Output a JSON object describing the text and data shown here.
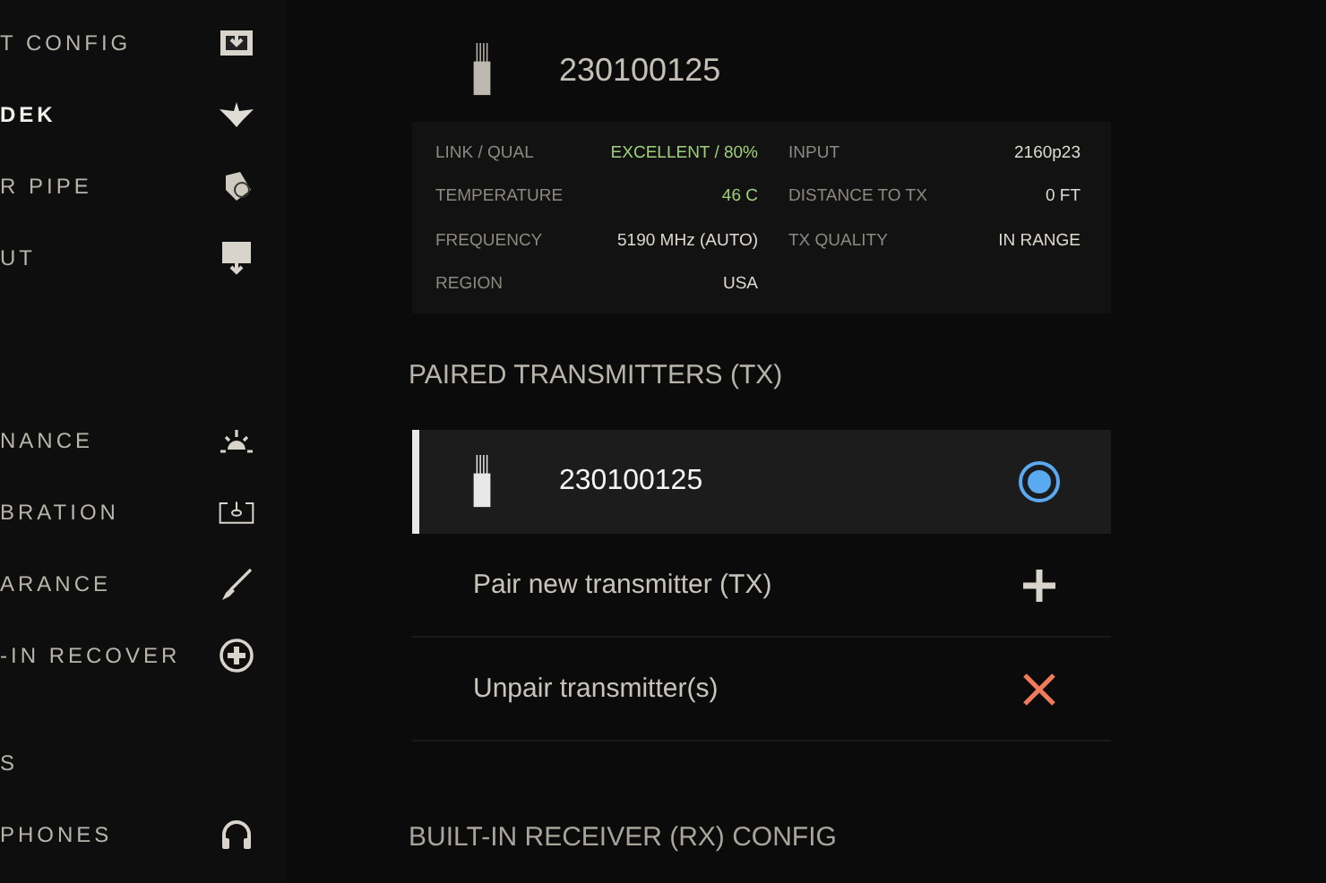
{
  "sidebar": {
    "groups": [
      {
        "items": [
          {
            "label": "T CONFIG",
            "selected": false
          },
          {
            "label": "DEK",
            "selected": true
          },
          {
            "label": "R PIPE",
            "selected": false
          },
          {
            "label": "UT",
            "selected": false
          }
        ]
      },
      {
        "items": [
          {
            "label": "NANCE",
            "selected": false
          },
          {
            "label": "BRATION",
            "selected": false
          },
          {
            "label": "ARANCE",
            "selected": false
          },
          {
            "label": "-IN RECOVER",
            "selected": false
          }
        ]
      },
      {
        "items": [
          {
            "label": "S",
            "selected": false
          },
          {
            "label": "PHONES",
            "selected": false
          }
        ]
      }
    ]
  },
  "device": {
    "serial": "230100125"
  },
  "info": [
    {
      "label": "LINK / QUAL",
      "value": "EXCELLENT / 80%",
      "highlight": true
    },
    {
      "label": "INPUT",
      "value": "2160p23",
      "highlight": false
    },
    {
      "label": "TEMPERATURE",
      "value": "46 C",
      "highlight": true
    },
    {
      "label": "DISTANCE TO TX",
      "value": "0 FT",
      "highlight": false
    },
    {
      "label": "FREQUENCY",
      "value": "5190 MHz (AUTO)",
      "highlight": false
    },
    {
      "label": "TX QUALITY",
      "value": "IN RANGE",
      "highlight": false
    },
    {
      "label": "REGION",
      "value": "USA",
      "highlight": false
    }
  ],
  "paired": {
    "title": "PAIRED TRANSMITTERS (TX)",
    "items": [
      {
        "kind": "transmitter",
        "label": "230100125",
        "selected": true
      },
      {
        "kind": "pair",
        "label": "Pair new transmitter (TX)"
      },
      {
        "kind": "unpair",
        "label": "Unpair transmitter(s)"
      }
    ]
  },
  "next_section": {
    "title": "BUILT-IN RECEIVER (RX) CONFIG"
  }
}
